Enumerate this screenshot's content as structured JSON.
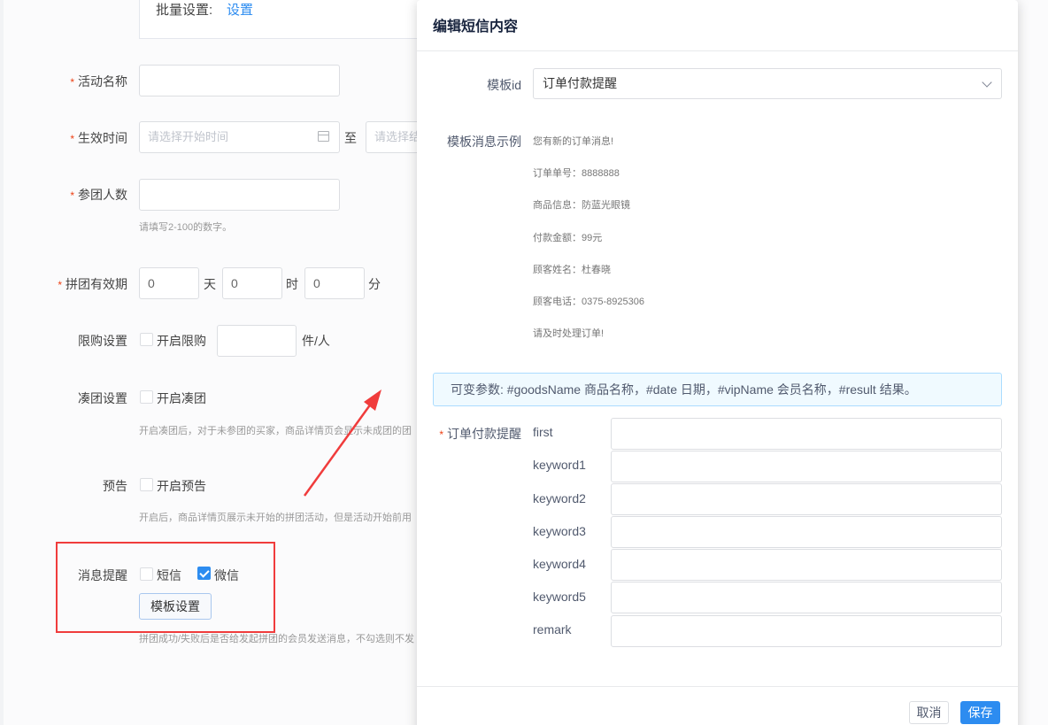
{
  "background_form": {
    "bulk": {
      "label": "批量设置:",
      "link": "设置"
    },
    "activity_name": {
      "label": "活动名称",
      "value": ""
    },
    "valid_time": {
      "label": "生效时间",
      "start_placeholder": "请选择开始时间",
      "separator": "至",
      "end_placeholder": "请选择结"
    },
    "group_size": {
      "label": "参团人数",
      "value": "",
      "hint": "请填写2-100的数字。"
    },
    "group_validity": {
      "label": "拼团有效期",
      "days": "0",
      "days_unit": "天",
      "hours": "0",
      "hours_unit": "时",
      "minutes": "0",
      "minutes_unit": "分"
    },
    "purchase_limit": {
      "label": "限购设置",
      "checkbox_label": "开启限购",
      "checked": false,
      "value": "",
      "unit": "件/人"
    },
    "fill_group": {
      "label": "凑团设置",
      "checkbox_label": "开启凑团",
      "checked": false,
      "hint": "开启凑团后，对于未参团的买家，商品详情页会显示未成团的团"
    },
    "preview": {
      "label": "预告",
      "checkbox_label": "开启预告",
      "checked": false,
      "hint": "开启后，商品详情页展示未开始的拼团活动，但是活动开始前用"
    },
    "notification": {
      "label": "消息提醒",
      "sms_label": "短信",
      "sms_checked": false,
      "wechat_label": "微信",
      "wechat_checked": true,
      "template_button": "模板设置",
      "hint": "拼团成功/失败后是否给发起拼团的会员发送消息，不勾选则不发"
    }
  },
  "modal": {
    "title": "编辑短信内容",
    "template_id": {
      "label": "模板id",
      "selected": "订单付款提醒"
    },
    "example": {
      "label": "模板消息示例",
      "lines": [
        "您有新的订单消息!",
        "订单单号：8888888",
        "商品信息：防蓝光眼镜",
        "付款金额：99元",
        "顾客姓名：杜春晓",
        "顾客电话：0375-8925306",
        "请及时处理订单!"
      ]
    },
    "variables_info": "可变参数: #goodsName 商品名称，#date 日期，#vipName 会员名称，#result 结果。",
    "fields": {
      "label": "订单付款提醒",
      "items": [
        {
          "key": "first",
          "value": ""
        },
        {
          "key": "keyword1",
          "value": ""
        },
        {
          "key": "keyword2",
          "value": ""
        },
        {
          "key": "keyword3",
          "value": ""
        },
        {
          "key": "keyword4",
          "value": ""
        },
        {
          "key": "keyword5",
          "value": ""
        },
        {
          "key": "remark",
          "value": ""
        }
      ]
    },
    "footer": {
      "cancel": "取消",
      "save": "保存"
    }
  },
  "colors": {
    "primary": "#2d8cf0",
    "required": "#ed4014",
    "annotation": "#f03c3c"
  },
  "icons": [
    "calendar-icon",
    "chevron-down-icon",
    "checkmark-icon",
    "annotation-arrow"
  ]
}
